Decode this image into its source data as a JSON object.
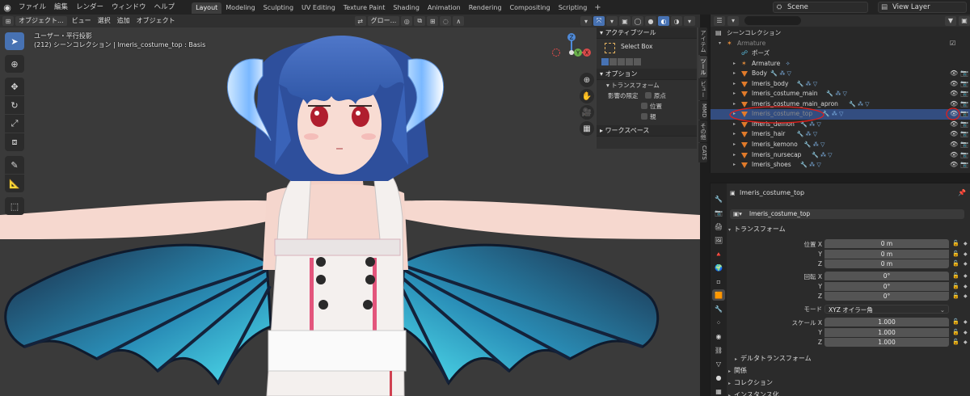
{
  "menubar": {
    "items": [
      "ファイル",
      "編集",
      "レンダー",
      "ウィンドウ",
      "ヘルプ"
    ],
    "workspaces": [
      "Layout",
      "Modeling",
      "Sculpting",
      "UV Editing",
      "Texture Paint",
      "Shading",
      "Animation",
      "Rendering",
      "Compositing",
      "Scripting"
    ],
    "active_workspace": "Layout",
    "scene": "Scene",
    "view_layer": "View Layer"
  },
  "viewport": {
    "mode": "オブジェクト...",
    "menus": [
      "ビュー",
      "選択",
      "追加",
      "オブジェクト"
    ],
    "transform_orientation": "グロー...",
    "view_name": "ユーザー・平行投影",
    "collection_info": "(212) シーンコレクション | lmeris_costume_top : Basis",
    "gizmo": {
      "z": "Z",
      "y": "Y",
      "x": "X"
    }
  },
  "npanel": {
    "active_tool_header": "アクティブツール",
    "tool_name": "Select Box",
    "options_header": "オプション",
    "transform_header": "トランスフォーム",
    "affect_only_label": "影響の限定",
    "affect_only": [
      "原点",
      "位置",
      "親"
    ],
    "workspace_header": "ワークスペース",
    "side_tabs": [
      "アイテム",
      "ツール",
      "ビュー",
      "MMD",
      "その他",
      "CATS"
    ],
    "active_side_tab": "ツール"
  },
  "outliner": {
    "root": "シーンコレクション",
    "rows": [
      {
        "name": "Armature",
        "depth": 1,
        "kind": "armature",
        "selected": false,
        "dim": true
      },
      {
        "name": "ポーズ",
        "depth": 2,
        "kind": "pose",
        "selected": false,
        "dim": false
      },
      {
        "name": "Armature",
        "depth": 2,
        "kind": "armature-data",
        "selected": false,
        "dim": false
      },
      {
        "name": "Body",
        "depth": 2,
        "kind": "mesh",
        "selected": false,
        "dim": false
      },
      {
        "name": "lmeris_body",
        "depth": 2,
        "kind": "mesh",
        "selected": false,
        "dim": false
      },
      {
        "name": "lmeris_costume_main",
        "depth": 2,
        "kind": "mesh",
        "selected": false,
        "dim": false
      },
      {
        "name": "lmeris_costume_main_apron",
        "depth": 2,
        "kind": "mesh",
        "selected": false,
        "dim": false
      },
      {
        "name": "lmeris_costume_top",
        "depth": 2,
        "kind": "mesh",
        "selected": true,
        "dim": true
      },
      {
        "name": "lmeris_demon",
        "depth": 2,
        "kind": "mesh",
        "selected": false,
        "dim": false
      },
      {
        "name": "lmeris_hair",
        "depth": 2,
        "kind": "mesh",
        "selected": false,
        "dim": false
      },
      {
        "name": "lmeris_kemono",
        "depth": 2,
        "kind": "mesh",
        "selected": false,
        "dim": false
      },
      {
        "name": "lmeris_nursecap",
        "depth": 2,
        "kind": "mesh",
        "selected": false,
        "dim": false
      },
      {
        "name": "lmeris_shoes",
        "depth": 2,
        "kind": "mesh",
        "selected": false,
        "dim": false
      }
    ]
  },
  "properties": {
    "object_name": "lmeris_costume_top",
    "object_field": "lmeris_costume_top",
    "transform_header": "トランスフォーム",
    "location_label": "位置 X",
    "location": [
      "0 m",
      "0 m",
      "0 m"
    ],
    "rotation_label": "回転 X",
    "rotation": [
      "0°",
      "0°",
      "0°"
    ],
    "axis_y": "Y",
    "axis_z": "Z",
    "mode_label": "モード",
    "mode_value": "XYZ オイラー角",
    "scale_label": "スケール X",
    "scale": [
      "1.000",
      "1.000",
      "1.000"
    ],
    "sections": [
      "デルタトランスフォーム",
      "関係",
      "コレクション",
      "インスタンス化"
    ]
  },
  "colors": {
    "accent": "#4772b3",
    "selection": "#334d80",
    "annotation": "#e0201c",
    "viewport_bg": "#3a3a3a"
  }
}
